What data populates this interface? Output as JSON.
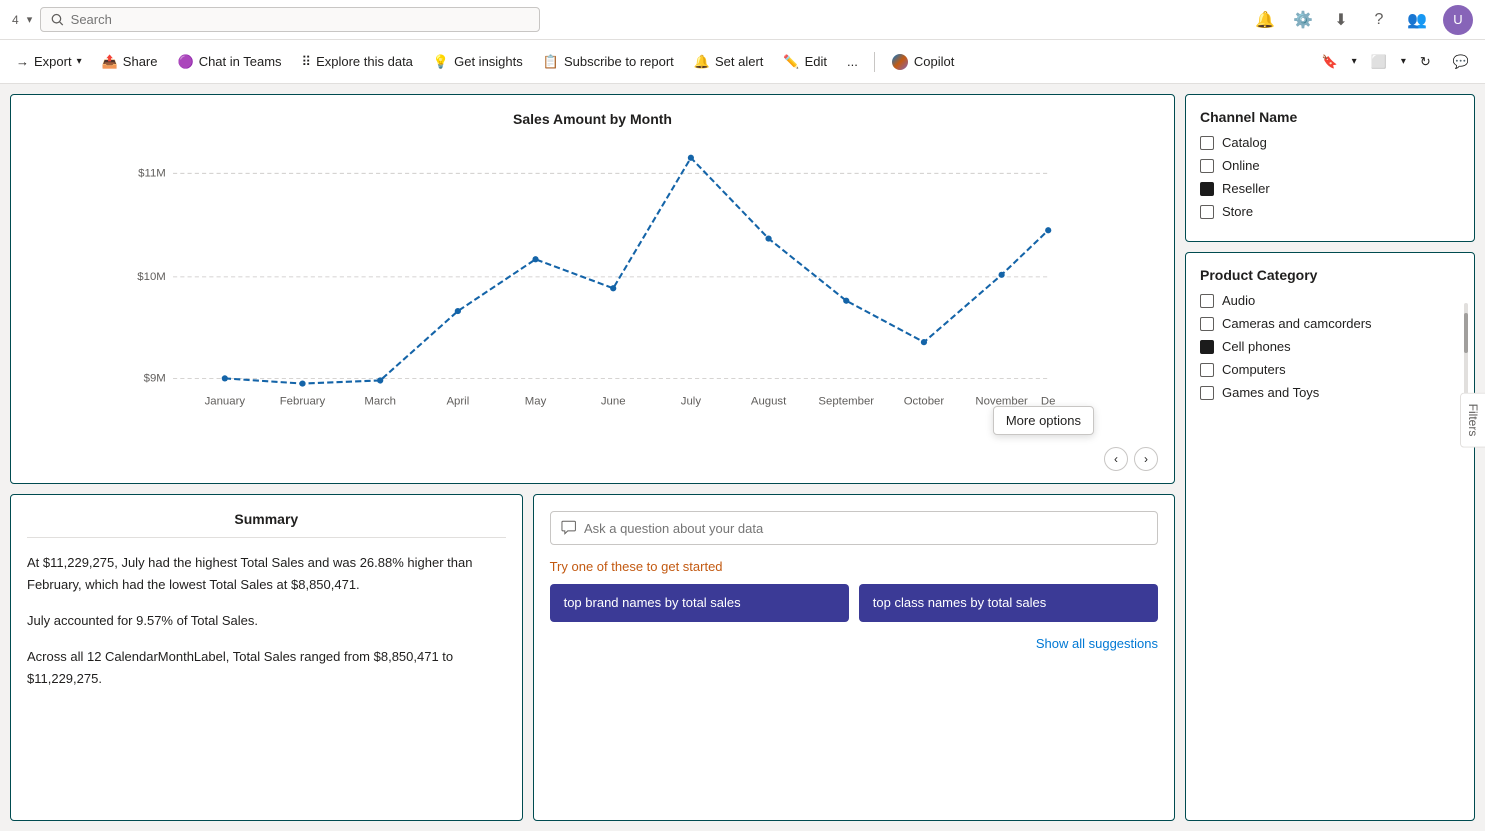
{
  "systemBar": {
    "tabNum": "4",
    "searchPlaceholder": "Search",
    "icons": [
      "bell",
      "settings",
      "download",
      "help",
      "people",
      "avatar"
    ]
  },
  "toolbar": {
    "export": "Export",
    "share": "Share",
    "chatInTeams": "Chat in Teams",
    "exploreData": "Explore this data",
    "getInsights": "Get insights",
    "subscribeToReport": "Subscribe to report",
    "setAlert": "Set alert",
    "edit": "Edit",
    "more": "...",
    "copilot": "Copilot"
  },
  "chart": {
    "title": "Sales Amount by Month",
    "yLabels": [
      "$11M",
      "$10M",
      "$9M"
    ],
    "xLabels": [
      "January",
      "February",
      "March",
      "April",
      "May",
      "June",
      "July",
      "August",
      "September",
      "October",
      "November",
      "De"
    ]
  },
  "channelFilter": {
    "title": "Channel Name",
    "items": [
      {
        "label": "Catalog",
        "checked": false
      },
      {
        "label": "Online",
        "checked": false
      },
      {
        "label": "Reseller",
        "checked": true
      },
      {
        "label": "Store",
        "checked": false
      }
    ]
  },
  "productFilter": {
    "title": "Product Category",
    "items": [
      {
        "label": "Audio",
        "checked": false
      },
      {
        "label": "Cameras and camcorders",
        "checked": false
      },
      {
        "label": "Cell phones",
        "checked": true
      },
      {
        "label": "Computers",
        "checked": false
      },
      {
        "label": "Games and Toys",
        "checked": false
      }
    ]
  },
  "summary": {
    "title": "Summary",
    "paragraph1": "At $11,229,275, July had the highest Total Sales and was 26.88% higher than February, which had the lowest Total Sales at $8,850,471.",
    "paragraph2": "July accounted for 9.57% of Total Sales.",
    "paragraph3": "Across all 12 CalendarMonthLabel, Total Sales ranged from $8,850,471 to $11,229,275."
  },
  "qa": {
    "placeholder": "Ask a question about your data",
    "suggestionsLabel": "Try one of these to get started",
    "suggestions": [
      {
        "label": "top brand names by total sales"
      },
      {
        "label": "top class names by total sales"
      }
    ],
    "showAll": "Show all suggestions"
  },
  "moreOptions": "More options",
  "filtersTab": "Filters"
}
